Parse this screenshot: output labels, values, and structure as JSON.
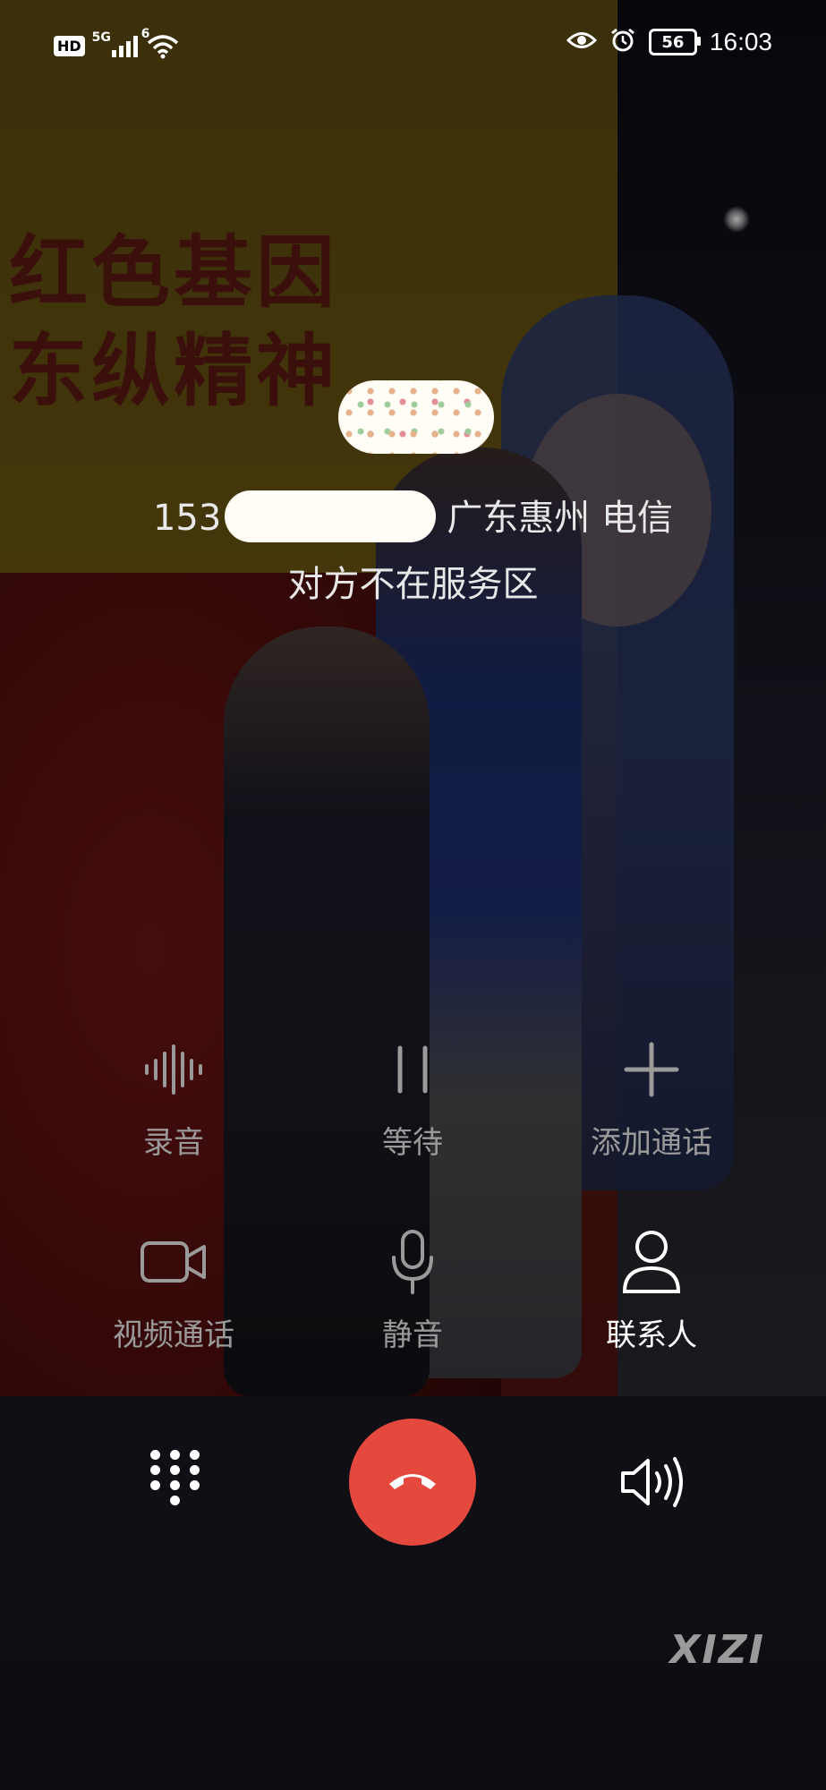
{
  "status_bar": {
    "left_badge": "HD",
    "network": "5G",
    "wifi_badge": "6",
    "battery_level": "56",
    "time": "16:03"
  },
  "call": {
    "number_prefix": "153",
    "location": "广东惠州 电信",
    "status": "对方不在服务区"
  },
  "controls_row1": [
    {
      "label": "录音",
      "icon": "waveform-icon"
    },
    {
      "label": "等待",
      "icon": "pause-icon"
    },
    {
      "label": "添加通话",
      "icon": "plus-icon"
    }
  ],
  "controls_row2": [
    {
      "label": "视频通话",
      "icon": "video-camera-icon"
    },
    {
      "label": "静音",
      "icon": "microphone-icon"
    },
    {
      "label": "联系人",
      "icon": "person-icon"
    }
  ],
  "background_slogan": [
    "红色基因",
    "东纵精神"
  ],
  "watermark": "XIZI",
  "colors": {
    "end_call": "#e5493d",
    "dim_label": "#9a9a9a"
  }
}
